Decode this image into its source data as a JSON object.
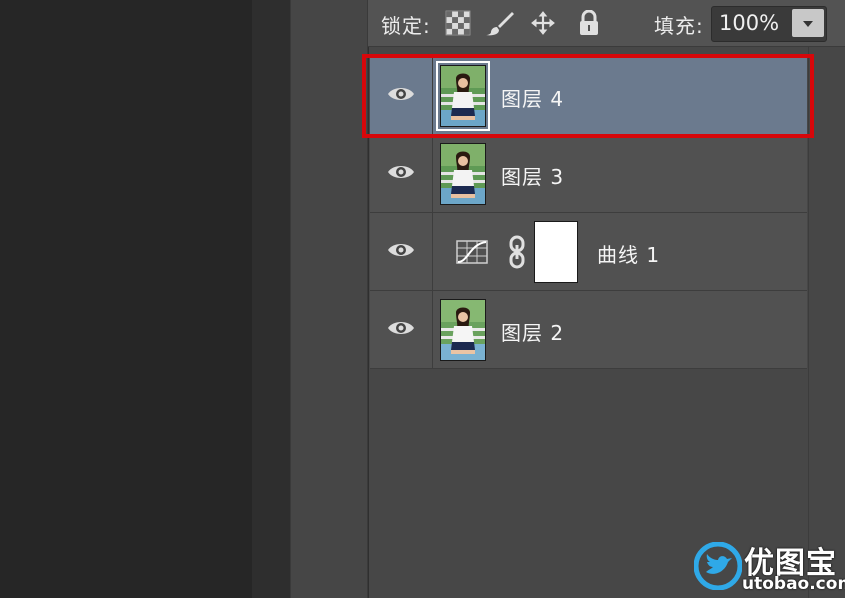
{
  "toolbar": {
    "lock_label": "锁定:",
    "fill_label": "填充:",
    "fill_value": "100%",
    "icons": [
      "lock-transparent-pixels-icon",
      "lock-image-pixels-icon",
      "lock-position-icon",
      "lock-all-icon",
      "fill-dropdown-arrow-icon"
    ]
  },
  "layers": [
    {
      "name": "图层 4",
      "type": "pixel",
      "selected": true,
      "visible": true,
      "highlighted": true
    },
    {
      "name": "图层 3",
      "type": "pixel",
      "selected": false,
      "visible": true
    },
    {
      "name": "曲线 1",
      "type": "adjustment-curves",
      "selected": false,
      "visible": true
    },
    {
      "name": "图层 2",
      "type": "pixel",
      "selected": false,
      "visible": true
    }
  ],
  "watermark": {
    "brand": "优图宝",
    "url": "utobao.com"
  },
  "colors": {
    "selected_row": "#6b7a8e",
    "highlight_box": "#d7070a",
    "panel_bg": "#474747"
  }
}
